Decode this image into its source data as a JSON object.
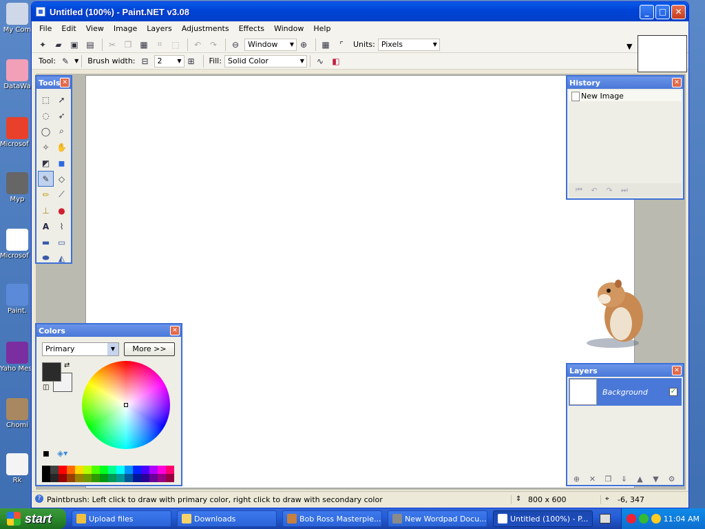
{
  "desktop": {
    "icons": [
      {
        "label": "My Com"
      },
      {
        "label": "DataWa"
      },
      {
        "label": "Microsof C++"
      },
      {
        "label": "Myp"
      },
      {
        "label": "Microsof Basic"
      },
      {
        "label": "Paint."
      },
      {
        "label": "Yaho Messe"
      },
      {
        "label": "Chomi"
      },
      {
        "label": "Rk"
      }
    ]
  },
  "window": {
    "title": "Untitled (100%) - Paint.NET v3.08",
    "minimize": "_",
    "maximize": "□",
    "close": "✕"
  },
  "menu": [
    "File",
    "Edit",
    "View",
    "Image",
    "Layers",
    "Adjustments",
    "Effects",
    "Window",
    "Help"
  ],
  "toolbar": {
    "zoom_value": "Window",
    "units_label": "Units:",
    "units_value": "Pixels"
  },
  "tool_options": {
    "tool_label": "Tool:",
    "brush_width_label": "Brush width:",
    "brush_width_value": "2",
    "fill_label": "Fill:",
    "fill_value": "Solid Color"
  },
  "panels": {
    "tools_title": "Tools",
    "history_title": "History",
    "history_items": [
      "New Image"
    ],
    "colors_title": "Colors",
    "colors_mode": "Primary",
    "colors_more": "More >>",
    "layers_title": "Layers",
    "layer_name": "Background"
  },
  "palette": [
    "#000000",
    "#404040",
    "#ff0000",
    "#ff6a00",
    "#ffd800",
    "#b6ff00",
    "#4cff00",
    "#00ff21",
    "#00ff90",
    "#00ffff",
    "#0094ff",
    "#0026ff",
    "#4800ff",
    "#b200ff",
    "#ff00dc",
    "#ff006e"
  ],
  "status": {
    "hint": "Paintbrush: Left click to draw with primary color, right click to draw with secondary color",
    "image_size": "800 x 600",
    "cursor_pos": "-6, 347"
  },
  "taskbar": {
    "start": "start",
    "items": [
      {
        "label": "Upload files",
        "color": "#f0c040"
      },
      {
        "label": "Downloads",
        "color": "#f6d36a"
      },
      {
        "label": "Bob Ross Masterpie...",
        "color": "#c68040"
      },
      {
        "label": "New Wordpad Docu...",
        "color": "#8a8a8a"
      },
      {
        "label": "Untitled (100%) - P...",
        "color": "#ffffff"
      }
    ],
    "clock": "11:04 AM"
  }
}
